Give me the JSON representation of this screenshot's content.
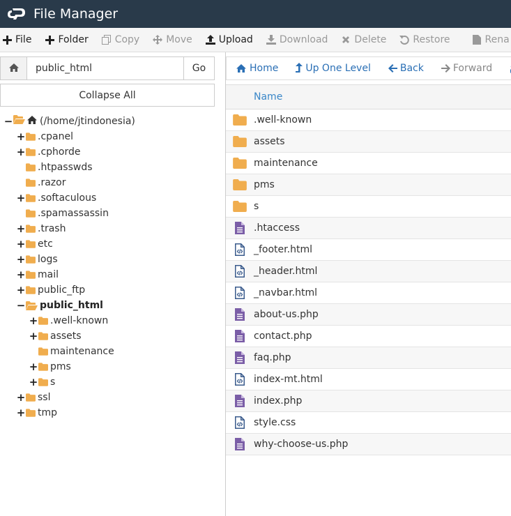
{
  "app": {
    "title": "File Manager",
    "logo_icon": "cpanel-logo-icon"
  },
  "colors": {
    "titlebar": "#293a4a",
    "folder": "#f0ad4e",
    "file_purple": "#7b5ea7",
    "link": "#2a6fb5"
  },
  "toolbar": {
    "items": [
      {
        "label": "File",
        "icon": "plus-icon",
        "disabled": false
      },
      {
        "label": "Folder",
        "icon": "plus-icon",
        "disabled": false
      },
      {
        "label": "Copy",
        "icon": "copy-icon",
        "disabled": true
      },
      {
        "label": "Move",
        "icon": "move-icon",
        "disabled": true
      },
      {
        "label": "Upload",
        "icon": "upload-icon",
        "disabled": false
      },
      {
        "label": "Download",
        "icon": "download-icon",
        "disabled": true
      },
      {
        "label": "Delete",
        "icon": "times-icon",
        "disabled": true
      },
      {
        "label": "Restore",
        "icon": "undo-icon",
        "disabled": true
      },
      {
        "label": "Rena",
        "icon": "file-icon",
        "disabled": true
      }
    ]
  },
  "pathbar": {
    "value": "public_html",
    "go_label": "Go"
  },
  "collapse_label": "Collapse All",
  "tree": [
    {
      "label": "(/home/jtindonesia)",
      "level": 0,
      "toggle": "−",
      "icon": "home",
      "bold": false
    },
    {
      "label": ".cpanel",
      "level": 1,
      "toggle": "+",
      "icon": "folder",
      "bold": false
    },
    {
      "label": ".cphorde",
      "level": 1,
      "toggle": "+",
      "icon": "folder",
      "bold": false
    },
    {
      "label": ".htpasswds",
      "level": 1,
      "toggle": "",
      "icon": "folder",
      "bold": false
    },
    {
      "label": ".razor",
      "level": 1,
      "toggle": "",
      "icon": "folder",
      "bold": false
    },
    {
      "label": ".softaculous",
      "level": 1,
      "toggle": "+",
      "icon": "folder",
      "bold": false
    },
    {
      "label": ".spamassassin",
      "level": 1,
      "toggle": "",
      "icon": "folder",
      "bold": false
    },
    {
      "label": ".trash",
      "level": 1,
      "toggle": "+",
      "icon": "folder",
      "bold": false
    },
    {
      "label": "etc",
      "level": 1,
      "toggle": "+",
      "icon": "folder",
      "bold": false
    },
    {
      "label": "logs",
      "level": 1,
      "toggle": "+",
      "icon": "folder",
      "bold": false
    },
    {
      "label": "mail",
      "level": 1,
      "toggle": "+",
      "icon": "folder",
      "bold": false
    },
    {
      "label": "public_ftp",
      "level": 1,
      "toggle": "+",
      "icon": "folder",
      "bold": false
    },
    {
      "label": "public_html",
      "level": 1,
      "toggle": "−",
      "icon": "folder-open",
      "bold": true
    },
    {
      "label": ".well-known",
      "level": 2,
      "toggle": "+",
      "icon": "folder",
      "bold": false
    },
    {
      "label": "assets",
      "level": 2,
      "toggle": "+",
      "icon": "folder",
      "bold": false
    },
    {
      "label": "maintenance",
      "level": 2,
      "toggle": "",
      "icon": "folder",
      "bold": false
    },
    {
      "label": "pms",
      "level": 2,
      "toggle": "+",
      "icon": "folder",
      "bold": false
    },
    {
      "label": "s",
      "level": 2,
      "toggle": "+",
      "icon": "folder",
      "bold": false
    },
    {
      "label": "ssl",
      "level": 1,
      "toggle": "+",
      "icon": "folder",
      "bold": false
    },
    {
      "label": "tmp",
      "level": 1,
      "toggle": "+",
      "icon": "folder",
      "bold": false
    }
  ],
  "nav": [
    {
      "label": "Home",
      "icon": "home-icon",
      "disabled": false
    },
    {
      "label": "Up One Level",
      "icon": "level-up-icon",
      "disabled": false
    },
    {
      "label": "Back",
      "icon": "arrow-left-icon",
      "disabled": false
    },
    {
      "label": "Forward",
      "icon": "arrow-right-icon",
      "disabled": true
    },
    {
      "label": "",
      "icon": "refresh-icon",
      "disabled": false
    }
  ],
  "table": {
    "header_name": "Name",
    "rows": [
      {
        "name": ".well-known",
        "type": "folder"
      },
      {
        "name": "assets",
        "type": "folder"
      },
      {
        "name": "maintenance",
        "type": "folder"
      },
      {
        "name": "pms",
        "type": "folder"
      },
      {
        "name": "s",
        "type": "folder"
      },
      {
        "name": ".htaccess",
        "type": "text"
      },
      {
        "name": "_footer.html",
        "type": "code"
      },
      {
        "name": "_header.html",
        "type": "code"
      },
      {
        "name": "_navbar.html",
        "type": "code"
      },
      {
        "name": "about-us.php",
        "type": "text"
      },
      {
        "name": "contact.php",
        "type": "text"
      },
      {
        "name": "faq.php",
        "type": "text"
      },
      {
        "name": "index-mt.html",
        "type": "code"
      },
      {
        "name": "index.php",
        "type": "text"
      },
      {
        "name": "style.css",
        "type": "code"
      },
      {
        "name": "why-choose-us.php",
        "type": "text"
      }
    ]
  }
}
